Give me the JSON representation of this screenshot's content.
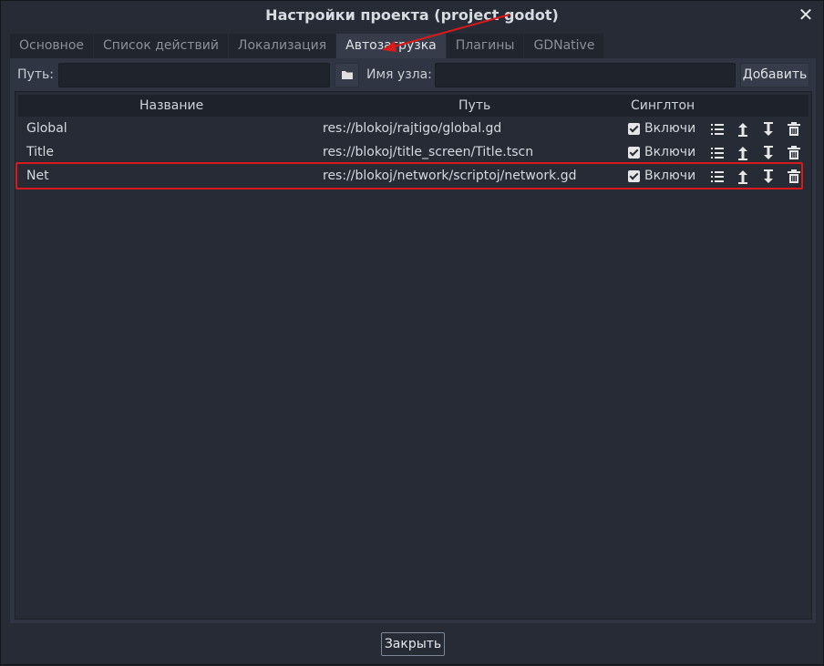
{
  "window": {
    "title": "Настройки проекта (project godot)"
  },
  "tabs": [
    {
      "label": "Основное",
      "active": false
    },
    {
      "label": "Список действий",
      "active": false
    },
    {
      "label": "Локализация",
      "active": false
    },
    {
      "label": "Автозагрузка",
      "active": true
    },
    {
      "label": "Плагины",
      "active": false
    },
    {
      "label": "GDNative",
      "active": false
    }
  ],
  "toolbar": {
    "path_label": "Путь:",
    "path_value": "",
    "node_label": "Имя узла:",
    "node_value": "",
    "add_label": "Добавить"
  },
  "table": {
    "headers": {
      "name": "Название",
      "path": "Путь",
      "singleton": "Синглтон"
    },
    "rows": [
      {
        "name": "Global",
        "path": "res://blokoj/rajtigo/global.gd",
        "enabled": true,
        "enabled_label": "Включи"
      },
      {
        "name": "Title",
        "path": "res://blokoj/title_screen/Title.tscn",
        "enabled": true,
        "enabled_label": "Включи"
      },
      {
        "name": "Net",
        "path": "res://blokoj/network/scriptoj/network.gd",
        "enabled": true,
        "enabled_label": "Включи"
      }
    ]
  },
  "footer": {
    "close_label": "Закрыть"
  },
  "colors": {
    "annotation": "#d81a1a",
    "accent": "#7b8797"
  },
  "icons": [
    "folder-icon",
    "list-icon",
    "move-up-icon",
    "move-down-icon",
    "delete-icon",
    "close-icon"
  ]
}
